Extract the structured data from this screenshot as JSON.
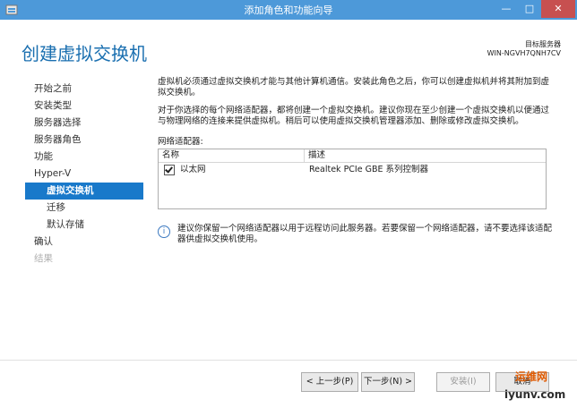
{
  "titlebar": {
    "title": "添加角色和功能向导",
    "min": "—",
    "max": "□",
    "close": "✕"
  },
  "header": {
    "page_title": "创建虚拟交换机",
    "dest_label": "目标服务器",
    "dest_value": "WIN-NGVH7QNH7CV"
  },
  "sidebar": {
    "items": [
      {
        "label": "开始之前"
      },
      {
        "label": "安装类型"
      },
      {
        "label": "服务器选择"
      },
      {
        "label": "服务器角色"
      },
      {
        "label": "功能"
      },
      {
        "label": "Hyper-V"
      },
      {
        "label": "虚拟交换机"
      },
      {
        "label": "迁移"
      },
      {
        "label": "默认存储"
      },
      {
        "label": "确认"
      },
      {
        "label": "结果"
      }
    ]
  },
  "content": {
    "para1": "虚拟机必须通过虚拟交换机才能与其他计算机通信。安装此角色之后，你可以创建虚拟机并将其附加到虚拟交换机。",
    "para2": "对于你选择的每个网络适配器，都将创建一个虚拟交换机。建议你现在至少创建一个虚拟交换机以便通过与物理网络的连接来提供虚拟机。稍后可以使用虚拟交换机管理器添加、删除或修改虚拟交换机。",
    "adapters_label": "网络适配器:",
    "table": {
      "headers": {
        "name": "名称",
        "desc": "描述"
      },
      "rows": [
        {
          "name": "以太网",
          "desc": "Realtek PCIe GBE 系列控制器",
          "checked": true
        }
      ]
    },
    "info": "建议你保留一个网络适配器以用于远程访问此服务器。若要保留一个网络适配器，请不要选择该适配器供虚拟交换机使用。"
  },
  "footer": {
    "prev": "< 上一步(P)",
    "next": "下一步(N) >",
    "install": "安装(I)",
    "cancel": "取消"
  },
  "watermark": {
    "brand": "运维网",
    "site": "iyunv.com"
  }
}
